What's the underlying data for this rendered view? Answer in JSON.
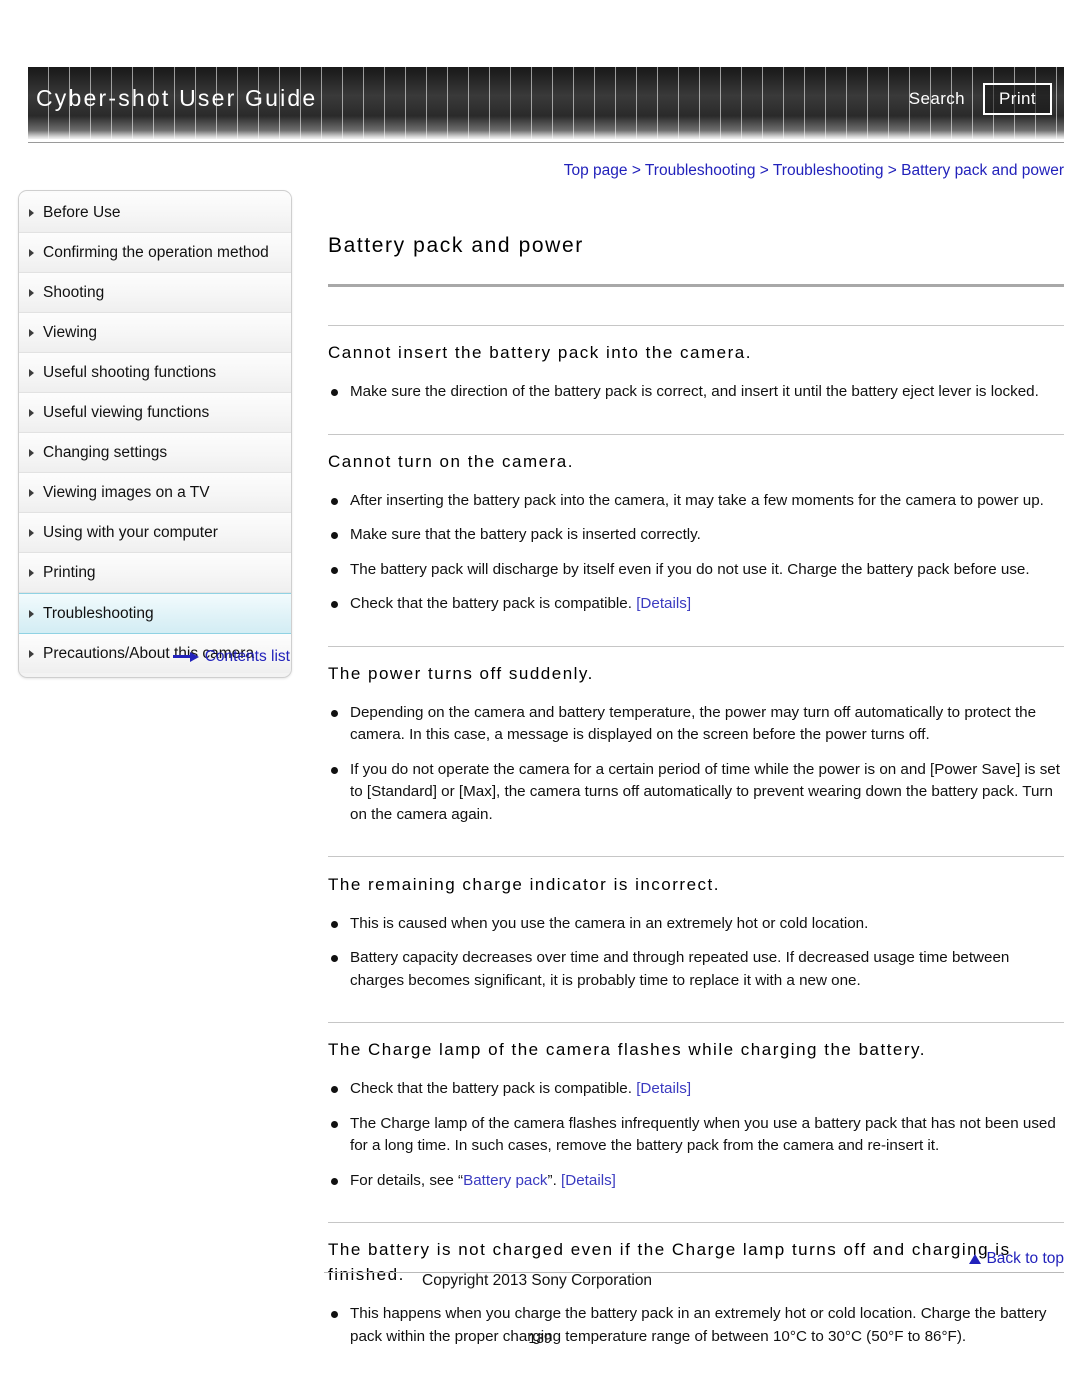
{
  "header": {
    "title": "Cyber-shot User Guide",
    "search_label": "Search",
    "print_label": "Print"
  },
  "breadcrumb": {
    "items": [
      "Top page",
      "Troubleshooting",
      "Troubleshooting",
      "Battery pack and power"
    ],
    "separator": ">",
    "full_text": "Top page > Troubleshooting > Troubleshooting > Battery pack and power"
  },
  "sidebar": {
    "items": [
      {
        "label": "Before Use",
        "selected": false
      },
      {
        "label": "Confirming the operation method",
        "selected": false
      },
      {
        "label": "Shooting",
        "selected": false
      },
      {
        "label": "Viewing",
        "selected": false
      },
      {
        "label": "Useful shooting functions",
        "selected": false
      },
      {
        "label": "Useful viewing functions",
        "selected": false
      },
      {
        "label": "Changing settings",
        "selected": false
      },
      {
        "label": "Viewing images on a TV",
        "selected": false
      },
      {
        "label": "Using with your computer",
        "selected": false
      },
      {
        "label": "Printing",
        "selected": false
      },
      {
        "label": "Troubleshooting",
        "selected": true
      },
      {
        "label": "Precautions/About this camera",
        "selected": false
      }
    ],
    "contents_list_label": "Contents list"
  },
  "main": {
    "page_title": "Battery pack and power",
    "sections": [
      {
        "heading": "Cannot insert the battery pack into the camera.",
        "bullets": [
          {
            "parts": [
              {
                "text": "Make sure the direction of the battery pack is correct, and insert it until the battery eject lever is locked.",
                "link": false
              }
            ]
          }
        ]
      },
      {
        "heading": "Cannot turn on the camera.",
        "bullets": [
          {
            "parts": [
              {
                "text": "After inserting the battery pack into the camera, it may take a few moments for the camera to power up.",
                "link": false
              }
            ]
          },
          {
            "parts": [
              {
                "text": "Make sure that the battery pack is inserted correctly.",
                "link": false
              }
            ]
          },
          {
            "parts": [
              {
                "text": "The battery pack will discharge by itself even if you do not use it. Charge the battery pack before use.",
                "link": false
              }
            ]
          },
          {
            "parts": [
              {
                "text": "Check that the battery pack is compatible. ",
                "link": false
              },
              {
                "text": "[Details]",
                "link": true
              }
            ]
          }
        ]
      },
      {
        "heading": "The power turns off suddenly.",
        "bullets": [
          {
            "parts": [
              {
                "text": "Depending on the camera and battery temperature, the power may turn off automatically to protect the camera. In this case, a message is displayed on the screen before the power turns off.",
                "link": false
              }
            ]
          },
          {
            "parts": [
              {
                "text": "If you do not operate the camera for a certain period of time while the power is on and [Power Save] is set to [Standard] or [Max], the camera turns off automatically to prevent wearing down the battery pack. Turn on the camera again.",
                "link": false
              }
            ]
          }
        ]
      },
      {
        "heading": "The remaining charge indicator is incorrect.",
        "bullets": [
          {
            "parts": [
              {
                "text": "This is caused when you use the camera in an extremely hot or cold location.",
                "link": false
              }
            ]
          },
          {
            "parts": [
              {
                "text": "Battery capacity decreases over time and through repeated use. If decreased usage time between charges becomes significant, it is probably time to replace it with a new one.",
                "link": false
              }
            ]
          }
        ]
      },
      {
        "heading": "The Charge lamp of the camera flashes while charging the battery.",
        "bullets": [
          {
            "parts": [
              {
                "text": "Check that the battery pack is compatible. ",
                "link": false
              },
              {
                "text": "[Details]",
                "link": true
              }
            ]
          },
          {
            "parts": [
              {
                "text": "The Charge lamp of the camera flashes infrequently when you use a battery pack that has not been used for a long time. In such cases, remove the battery pack from the camera and re-insert it.",
                "link": false
              }
            ]
          },
          {
            "parts": [
              {
                "text": "For details, see “",
                "link": false
              },
              {
                "text": "Battery pack",
                "link": true
              },
              {
                "text": "”. ",
                "link": false
              },
              {
                "text": "[Details]",
                "link": true
              }
            ]
          }
        ]
      },
      {
        "heading": "The battery is not charged even if the Charge lamp turns off and charging is finished.",
        "bullets": [
          {
            "parts": [
              {
                "text": "This happens when you charge the battery pack in an extremely hot or cold location. Charge the battery pack within the proper charging temperature range of between 10°C to 30°C (50°F to 86°F).",
                "link": false
              }
            ]
          }
        ]
      }
    ]
  },
  "footer": {
    "back_to_top_label": "Back to top",
    "copyright": "Copyright 2013 Sony Corporation",
    "page_number": "139"
  },
  "colors": {
    "link": "#2222bb",
    "inline_link": "#3a3ac0",
    "header_bg": "#2a2a2a",
    "selected_nav": "#dff2f7",
    "rule": "#c6c6c6"
  }
}
